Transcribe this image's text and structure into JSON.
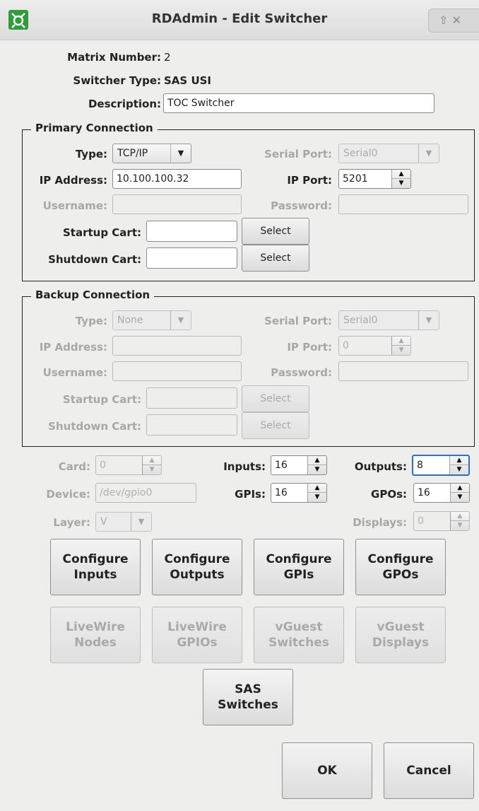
{
  "window": {
    "title": "RDAdmin - Edit Switcher",
    "controls": "⇧ ✕"
  },
  "info": {
    "matrix_number_label": "Matrix Number:",
    "matrix_number": "2",
    "switcher_type_label": "Switcher Type:",
    "switcher_type": "SAS USI",
    "description_label": "Description:",
    "description": "TOC Switcher"
  },
  "primary": {
    "title": "Primary Connection",
    "type_label": "Type:",
    "type": "TCP/IP",
    "serial_port_label": "Serial Port:",
    "serial_port": "Serial0",
    "ip_address_label": "IP Address:",
    "ip_address": "10.100.100.32",
    "ip_port_label": "IP Port:",
    "ip_port": "5201",
    "username_label": "Username:",
    "username": "",
    "password_label": "Password:",
    "password": "",
    "startup_cart_label": "Startup Cart:",
    "startup_cart": "",
    "shutdown_cart_label": "Shutdown Cart:",
    "shutdown_cart": "",
    "select_label": "Select"
  },
  "backup": {
    "title": "Backup Connection",
    "type_label": "Type:",
    "type": "None",
    "serial_port_label": "Serial Port:",
    "serial_port": "Serial0",
    "ip_address_label": "IP Address:",
    "ip_address": "",
    "ip_port_label": "IP Port:",
    "ip_port": "0",
    "username_label": "Username:",
    "username": "",
    "password_label": "Password:",
    "password": "",
    "startup_cart_label": "Startup Cart:",
    "startup_cart": "",
    "shutdown_cart_label": "Shutdown Cart:",
    "shutdown_cart": "",
    "select_label": "Select"
  },
  "settings": {
    "card_label": "Card:",
    "card": "0",
    "inputs_label": "Inputs:",
    "inputs": "16",
    "outputs_label": "Outputs:",
    "outputs": "8",
    "device_label": "Device:",
    "device": "/dev/gpio0",
    "gpis_label": "GPIs:",
    "gpis": "16",
    "gpos_label": "GPOs:",
    "gpos": "16",
    "layer_label": "Layer:",
    "layer": "V",
    "displays_label": "Displays:",
    "displays": "0"
  },
  "buttons": {
    "configure_inputs": [
      "Configure",
      "Inputs"
    ],
    "configure_outputs": [
      "Configure",
      "Outputs"
    ],
    "configure_gpis": [
      "Configure",
      "GPIs"
    ],
    "configure_gpos": [
      "Configure",
      "GPOs"
    ],
    "livewire_nodes": [
      "LiveWire",
      "Nodes"
    ],
    "livewire_gpios": [
      "LiveWire",
      "GPIOs"
    ],
    "vguest_switches": [
      "vGuest",
      "Switches"
    ],
    "vguest_displays": [
      "vGuest",
      "Displays"
    ],
    "sas_switches": [
      "SAS",
      "Switches"
    ],
    "ok": "OK",
    "cancel": "Cancel"
  },
  "colors": {
    "background": "#eeeeec",
    "focus": "#2a6fdb",
    "disabled_text": "#a7a7a7",
    "app_icon": "#2f9e3a"
  }
}
